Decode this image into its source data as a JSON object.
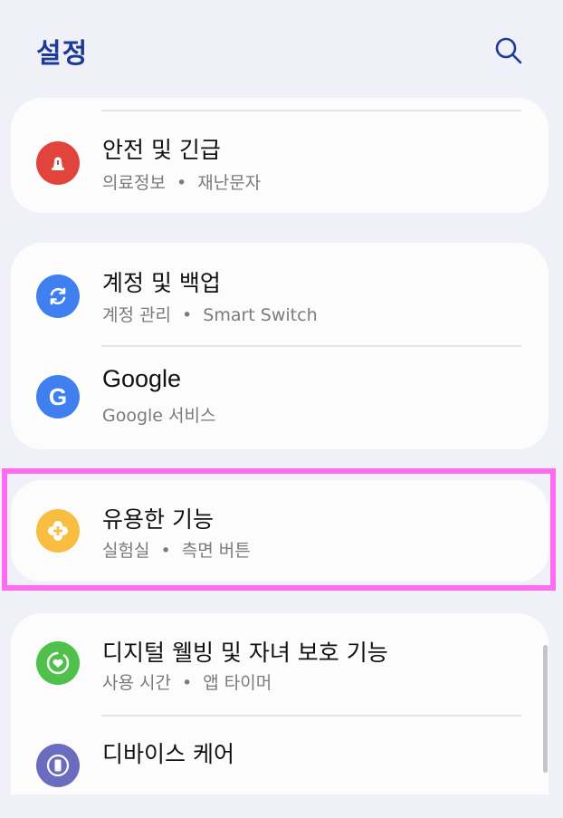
{
  "header": {
    "title": "설정",
    "search_icon": "search-icon"
  },
  "colors": {
    "title": "#1d3b96",
    "safety": "#e0443c",
    "accounts": "#3f7fef",
    "google": "#3f7fef",
    "advanced": "#f9bd42",
    "wellbeing": "#4fc04a",
    "device_care": "#6a6cc0",
    "highlight": "#ff6cf0"
  },
  "items": {
    "safety": {
      "title": "안전 및 긴급",
      "sub1": "의료정보",
      "sub2": "재난문자",
      "icon": "siren-icon"
    },
    "accounts": {
      "title": "계정 및 백업",
      "sub1": "계정 관리",
      "sub2": "Smart Switch",
      "icon": "sync-icon"
    },
    "google": {
      "title": "Google",
      "sub": "Google 서비스",
      "icon": "google-icon",
      "glyph": "G"
    },
    "advanced": {
      "title": "유용한 기능",
      "sub1": "실험실",
      "sub2": "측면 버튼",
      "icon": "plus-gear-icon"
    },
    "wellbeing": {
      "title": "디지털 웰빙 및 자녀 보호 기능",
      "sub1": "사용 시간",
      "sub2": "앱 타이머",
      "icon": "heart-icon"
    },
    "device_care": {
      "title": "디바이스 케어",
      "icon": "battery-icon"
    }
  },
  "separator": "•"
}
